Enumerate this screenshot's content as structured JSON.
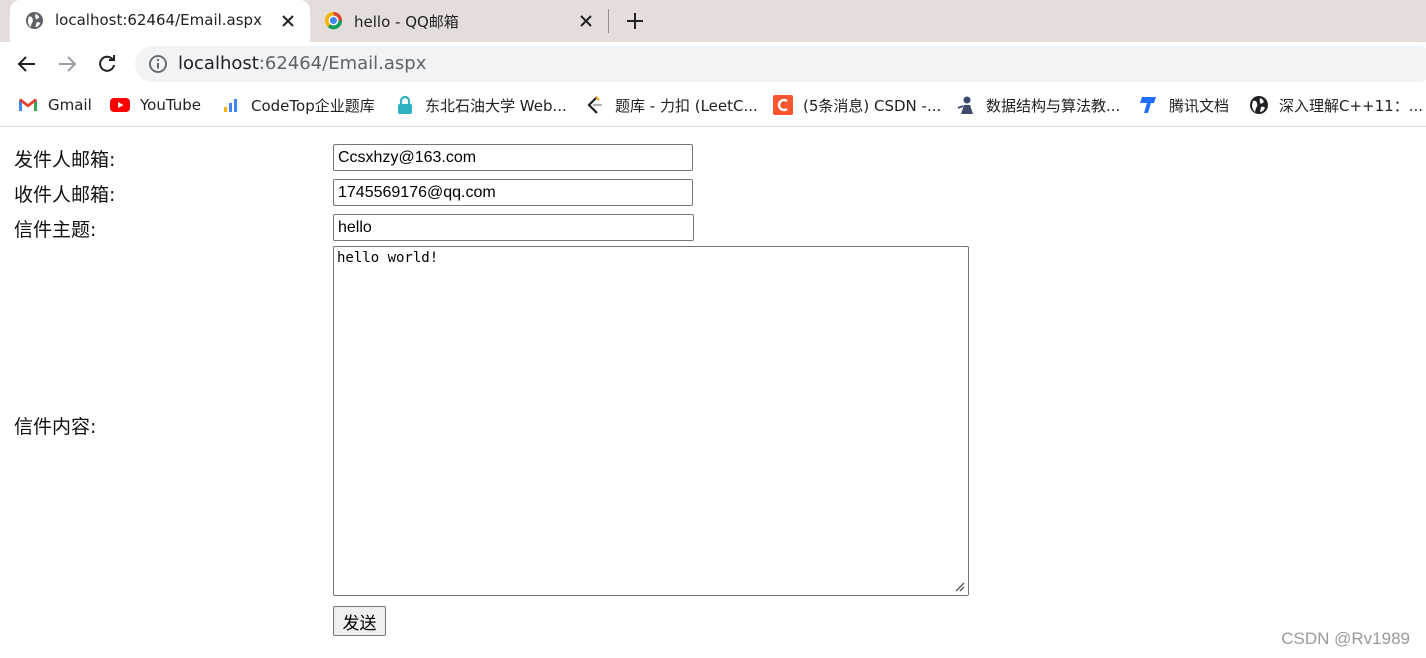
{
  "browser": {
    "tabs": [
      {
        "title": "localhost:62464/Email.aspx",
        "icon": "globe-icon",
        "active": true
      },
      {
        "title": "hello - QQ邮箱",
        "icon": "qq-mail-icon",
        "active": false
      }
    ],
    "address": {
      "host": "localhost",
      "rest": ":62464/Email.aspx"
    },
    "bookmarks": [
      {
        "label": "Gmail",
        "icon": "gmail-icon"
      },
      {
        "label": "YouTube",
        "icon": "youtube-icon"
      },
      {
        "label": "CodeTop企业题库",
        "icon": "codetop-icon"
      },
      {
        "label": "东北石油大学 Web...",
        "icon": "lock-icon"
      },
      {
        "label": "题库 - 力扣 (LeetC...",
        "icon": "leetcode-icon"
      },
      {
        "label": "(5条消息) CSDN -...",
        "icon": "csdn-icon"
      },
      {
        "label": "数据结构与算法教...",
        "icon": "person-icon"
      },
      {
        "label": "腾讯文档",
        "icon": "tencent-docs-icon"
      },
      {
        "label": "深入理解C++11：...",
        "icon": "globe-icon"
      }
    ]
  },
  "form": {
    "sender_label": "发件人邮箱:",
    "sender_value": "Ccsxhzy@163.com",
    "recipient_label": "收件人邮箱:",
    "recipient_value": "1745569176@qq.com",
    "subject_label": "信件主题:",
    "subject_value": "hello",
    "content_label": "信件内容:",
    "content_value": "hello world!",
    "send_label": "发送"
  },
  "watermark": "CSDN @Rv1989",
  "colors": {
    "tabstrip": "#e5ddda",
    "omnibox": "#f1f3f4",
    "gmail_red": "#ea4335",
    "youtube_red": "#ff0000",
    "csdn_orange": "#fc5531"
  }
}
